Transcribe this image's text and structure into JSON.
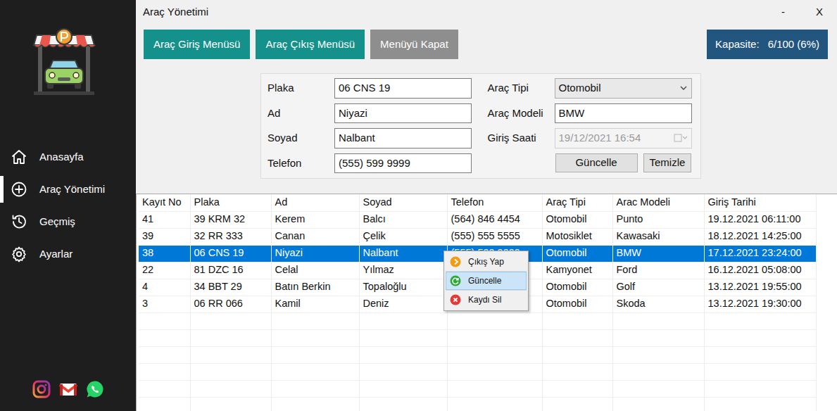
{
  "window": {
    "title": "Araç Yönetimi",
    "minimize": "-",
    "close": "X"
  },
  "sidebar": {
    "items": [
      {
        "label": "Anasayfa",
        "selected": false
      },
      {
        "label": "Araç Yönetimi",
        "selected": true
      },
      {
        "label": "Geçmiş",
        "selected": false
      },
      {
        "label": "Ayarlar",
        "selected": false
      }
    ]
  },
  "toolbar": {
    "buttons": [
      {
        "label": "Araç Giriş Menüsü",
        "kind": "primary"
      },
      {
        "label": "Araç Çıkış Menüsü",
        "kind": "primary"
      },
      {
        "label": "Menüyü Kapat",
        "kind": "secondary"
      }
    ],
    "capacity": {
      "label": "Kapasite:",
      "value": "6/100 (6%)"
    }
  },
  "form": {
    "left": [
      {
        "label": "Plaka",
        "value": "06 CNS 19",
        "kind": "text",
        "disabled": false
      },
      {
        "label": "Ad",
        "value": "Niyazi",
        "kind": "text",
        "disabled": false
      },
      {
        "label": "Soyad",
        "value": "Nalbant",
        "kind": "text",
        "disabled": false
      },
      {
        "label": "Telefon",
        "value": "(555) 599 9999",
        "kind": "text",
        "disabled": false
      }
    ],
    "right": [
      {
        "label": "Araç Tipi",
        "value": "Otomobil",
        "kind": "select",
        "disabled": false
      },
      {
        "label": "Araç Modeli",
        "value": "BMW",
        "kind": "text",
        "disabled": false
      },
      {
        "label": "Giriş Saati",
        "value": "19/12/2021 16:54",
        "kind": "datetime",
        "disabled": true
      }
    ],
    "buttons": [
      "Güncelle",
      "Temizle"
    ]
  },
  "table": {
    "columns": [
      "Kayıt No",
      "Plaka",
      "Ad",
      "Soyad",
      "Telefon",
      "Araç Tipi",
      "Arac Modeli",
      "Giriş Tarihi"
    ],
    "rows": [
      {
        "cells": [
          "41",
          "39 KRM 32",
          "Kerem",
          "Balcı",
          "(564) 846 4454",
          "Otomobil",
          "Punto",
          "19.12.2021 06:11:00"
        ],
        "selected": false
      },
      {
        "cells": [
          "39",
          "32 RR 333",
          "Canan",
          "Çelik",
          "(555) 555 5555",
          "Motosiklet",
          "Kawasaki",
          "18.12.2021 14:25:00"
        ],
        "selected": false
      },
      {
        "cells": [
          "38",
          "06 CNS 19",
          "Niyazi",
          "Nalbant",
          "(555) 599 9999",
          "Otomobil",
          "BMW",
          "17.12.2021 23:24:00"
        ],
        "selected": true
      },
      {
        "cells": [
          "22",
          "81 DZC 16",
          "Celal",
          "Yılmaz",
          "",
          "Kamyonet",
          "Ford",
          "16.12.2021 05:08:00"
        ],
        "selected": false
      },
      {
        "cells": [
          "4",
          "34 BBT 29",
          "Batın Berkin",
          "Topaloğlu",
          "",
          "Otomobil",
          "Golf",
          "13.12.2021 19:55:00"
        ],
        "selected": false
      },
      {
        "cells": [
          "3",
          "06 RR 066",
          "Kamil",
          "Deniz",
          "",
          "Otomobil",
          "Skoda",
          "13.12.2021 19:30:00"
        ],
        "selected": false
      }
    ]
  },
  "context_menu": {
    "items": [
      {
        "label": "Çıkış Yap",
        "selected": false,
        "color": "#f39c12"
      },
      {
        "label": "Güncelle",
        "selected": true,
        "color": "#2eaa3a"
      },
      {
        "label": "Kaydı Sil",
        "selected": false,
        "color": "#e53935"
      }
    ]
  }
}
